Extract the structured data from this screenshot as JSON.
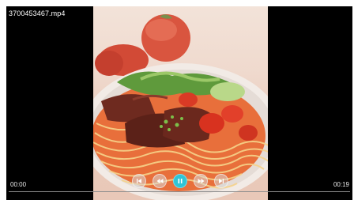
{
  "player": {
    "filename": "3700453467.mp4",
    "elapsed": "00:00",
    "duration": "00:19",
    "progress_fraction": 0.0,
    "playing": true,
    "accent_color": "#2ec4d6"
  },
  "controls": [
    {
      "name": "previous-icon"
    },
    {
      "name": "rewind-icon"
    },
    {
      "name": "pause-icon"
    },
    {
      "name": "fast-forward-icon"
    },
    {
      "name": "next-icon"
    }
  ]
}
